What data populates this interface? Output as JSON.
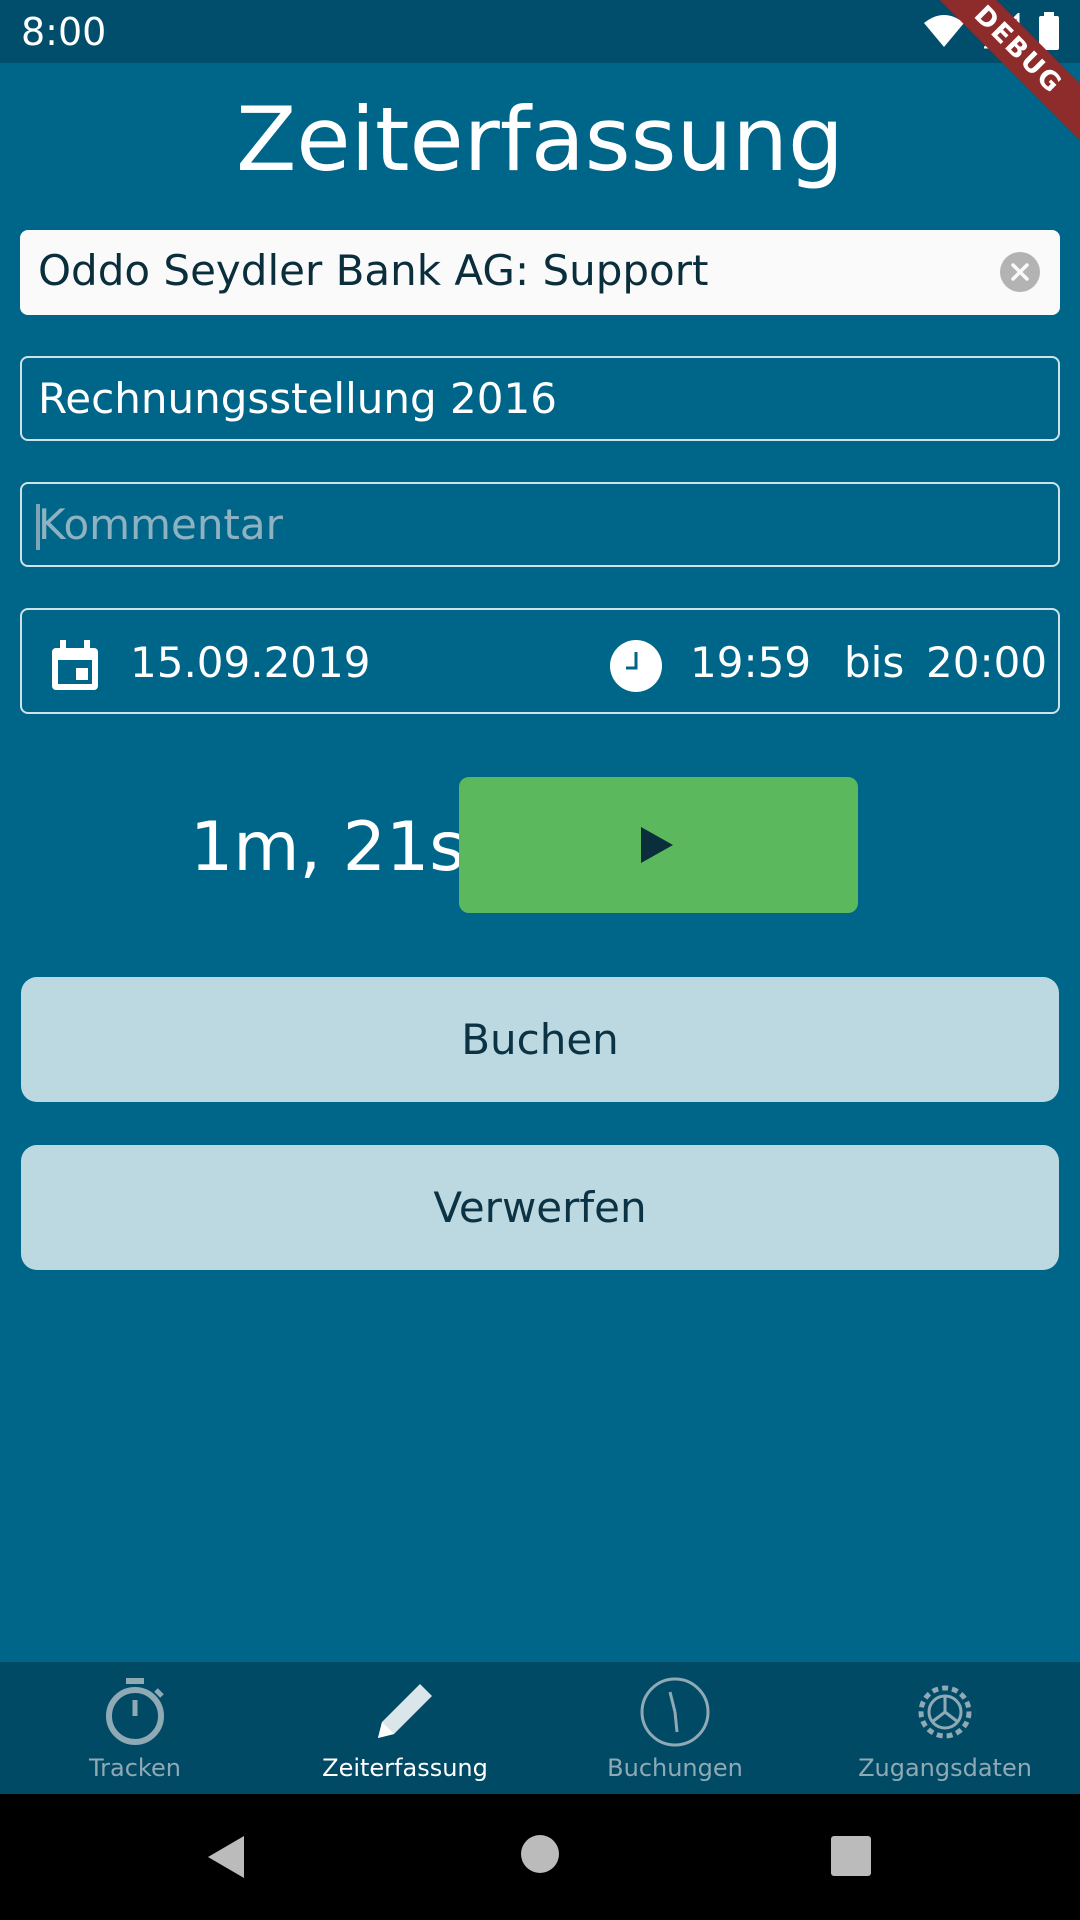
{
  "status_bar": {
    "time": "8:00",
    "debug_banner": "DEBUG"
  },
  "page": {
    "title": "Zeiterfassung"
  },
  "form": {
    "project_value": "Oddo Seydler Bank AG: Support",
    "task_value": "Rechnungsstellung 2016",
    "comment_placeholder": "Kommentar",
    "date": "15.09.2019",
    "time_from": "19:59",
    "time_separator": "bis",
    "time_to": "20:00"
  },
  "timer": {
    "elapsed": "1m, 21s"
  },
  "actions": {
    "book_label": "Buchen",
    "discard_label": "Verwerfen"
  },
  "bottom_nav": {
    "items": [
      {
        "label": "Tracken",
        "icon": "stopwatch-icon"
      },
      {
        "label": "Zeiterfassung",
        "icon": "pencil-icon",
        "active": true
      },
      {
        "label": "Buchungen",
        "icon": "clock-icon"
      },
      {
        "label": "Zugangsdaten",
        "icon": "gear-icon"
      }
    ]
  },
  "colors": {
    "background": "#006689",
    "status_bar": "#004e6b",
    "play_button": "#5cb85c",
    "action_button": "#bcd8e0",
    "bottom_nav": "#004a66"
  }
}
